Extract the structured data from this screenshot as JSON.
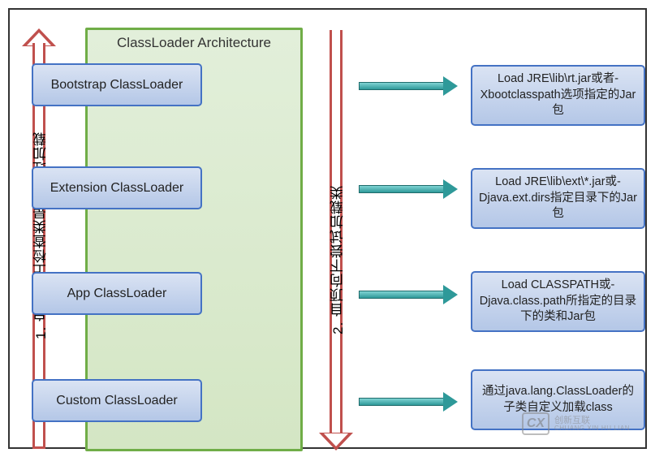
{
  "container_title": "ClassLoader Architecture",
  "arrows": {
    "up_label": "1. 自底向上检查类是否已经加载",
    "down_label": "2. 自顶向下尝试加载类"
  },
  "loaders": [
    {
      "name": "Bootstrap ClassLoader",
      "desc": "Load JRE\\lib\\rt.jar或者-Xbootclasspath选项指定的Jar包"
    },
    {
      "name": "Extension ClassLoader",
      "desc": "Load JRE\\lib\\ext\\*.jar或-Djava.ext.dirs指定目录下的Jar包"
    },
    {
      "name": "App ClassLoader",
      "desc": "Load CLASSPATH或-Djava.class.path所指定的目录下的类和Jar包"
    },
    {
      "name": "Custom ClassLoader",
      "desc": "通过java.lang.ClassLoader的子类自定义加载class"
    }
  ],
  "watermark": {
    "logo": "CX",
    "line1": "创新互联",
    "line2": "CHUANG XIN HU LIAN"
  },
  "layout": {
    "loader_tops": [
      66,
      193,
      323,
      455
    ],
    "desc_tops": [
      68,
      195,
      322,
      443
    ],
    "harrow_tops": [
      86,
      213,
      343,
      475
    ]
  }
}
